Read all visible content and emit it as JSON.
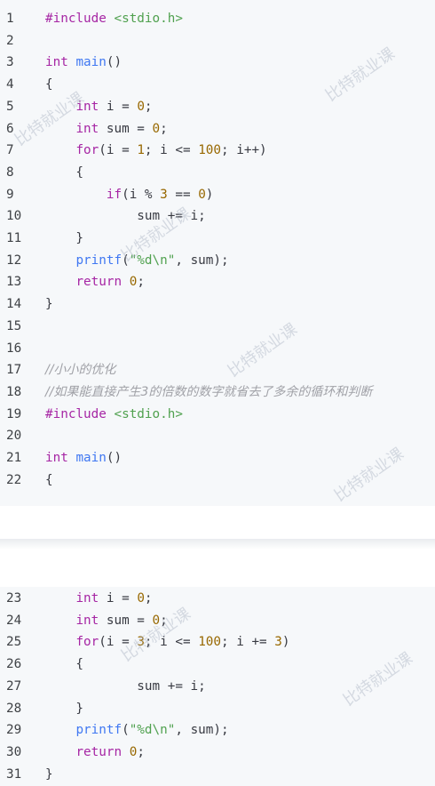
{
  "watermark": "比特就业课",
  "block1": {
    "lines": [
      {
        "n": "1",
        "t": "#include <stdio.h>"
      },
      {
        "n": "2",
        "t": ""
      },
      {
        "n": "3",
        "t": "int main()"
      },
      {
        "n": "4",
        "t": "{"
      },
      {
        "n": "5",
        "t": "    int i = 0;"
      },
      {
        "n": "6",
        "t": "    int sum = 0;"
      },
      {
        "n": "7",
        "t": "    for(i = 1; i <= 100; i++)"
      },
      {
        "n": "8",
        "t": "    {"
      },
      {
        "n": "9",
        "t": "        if(i % 3 == 0)"
      },
      {
        "n": "10",
        "t": "            sum += i;"
      },
      {
        "n": "11",
        "t": "    }"
      },
      {
        "n": "12",
        "t": "    printf(\"%d\\n\", sum);"
      },
      {
        "n": "13",
        "t": "    return 0;"
      },
      {
        "n": "14",
        "t": "}"
      },
      {
        "n": "15",
        "t": ""
      },
      {
        "n": "16",
        "t": ""
      },
      {
        "n": "17",
        "t": "//小小的优化"
      },
      {
        "n": "18",
        "t": "//如果能直接产生3的倍数的数字就省去了多余的循环和判断"
      },
      {
        "n": "19",
        "t": "#include <stdio.h>"
      },
      {
        "n": "20",
        "t": ""
      },
      {
        "n": "21",
        "t": "int main()"
      },
      {
        "n": "22",
        "t": "{"
      }
    ]
  },
  "block2": {
    "lines": [
      {
        "n": "23",
        "t": "    int i = 0;"
      },
      {
        "n": "24",
        "t": "    int sum = 0;"
      },
      {
        "n": "25",
        "t": "    for(i = 3; i <= 100; i += 3)"
      },
      {
        "n": "26",
        "t": "    {"
      },
      {
        "n": "27",
        "t": "            sum += i;"
      },
      {
        "n": "28",
        "t": "    }"
      },
      {
        "n": "29",
        "t": "    printf(\"%d\\n\", sum);"
      },
      {
        "n": "30",
        "t": "    return 0;"
      },
      {
        "n": "31",
        "t": "}"
      }
    ]
  },
  "colors": {
    "background": "#f6f8fa",
    "keyword": "#a626a4",
    "function": "#4078f2",
    "number": "#986801",
    "string": "#50a14f",
    "comment": "#a0a1a7"
  }
}
